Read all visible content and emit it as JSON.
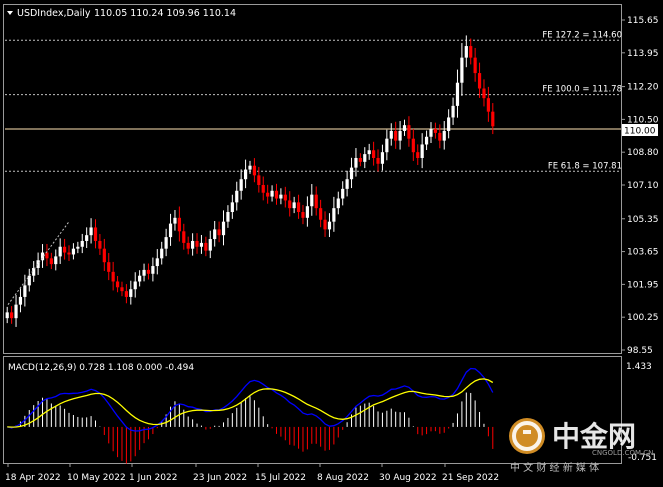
{
  "header": {
    "symbol": "USDIndex,Daily",
    "ohlc": "110.05 110.24 109.96 110.14",
    "menu_icon": "triangle-down-icon"
  },
  "price_axis": {
    "ticks": [
      "115.65",
      "113.95",
      "112.20",
      "110.50",
      "108.80",
      "107.10",
      "105.35",
      "103.65",
      "101.95",
      "100.25",
      "98.55"
    ],
    "current_price_label": "110.00"
  },
  "fib_levels": [
    {
      "label": "FE 127.2 = 114.60",
      "value": 114.6
    },
    {
      "label": "FE 100.0 = 111.78",
      "value": 111.78
    },
    {
      "label": "FE 61.8 = 107.81",
      "value": 107.81
    }
  ],
  "macd": {
    "label": "MACD(12,26,9) 0.728 1.108 0.000 -0.494",
    "axis_top": "1.433",
    "axis_bottom": "-0.751"
  },
  "time_axis": {
    "ticks": [
      "18 Apr 2022",
      "10 May 2022",
      "1 Jun 2022",
      "23 Jun 2022",
      "15 Jul 2022",
      "8 Aug 2022",
      "30 Aug 2022",
      "21 Sep 2022"
    ]
  },
  "watermark": {
    "brand": "中金网",
    "domain": "CNGOLD.COM.CN",
    "slogan": "中 文 财 经 新 媒 体",
    "logo_icon": "cngold-logo-icon"
  },
  "colors": {
    "background": "#000000",
    "bull": "#ffffff",
    "bear": "#ff0000",
    "macd_line": "#0000ff",
    "signal_line": "#ffff00",
    "fib_line": "#c0c0c0",
    "price_line": "#ffe4b5"
  },
  "chart_data": {
    "type": "candlestick",
    "title": "USDIndex,Daily",
    "price_ylim": [
      98.55,
      115.65
    ],
    "x_tick_labels": [
      "18 Apr 2022",
      "10 May 2022",
      "1 Jun 2022",
      "23 Jun 2022",
      "15 Jul 2022",
      "8 Aug 2022",
      "30 Aug 2022",
      "21 Sep 2022"
    ],
    "last_close": 110.14,
    "close": [
      100.5,
      100.2,
      100.9,
      101.3,
      101.9,
      102.4,
      102.8,
      103.2,
      103.6,
      103.3,
      103.0,
      103.4,
      103.9,
      103.6,
      103.5,
      103.8,
      103.9,
      104.2,
      104.5,
      104.9,
      104.2,
      103.8,
      103.1,
      102.6,
      102.1,
      101.8,
      101.6,
      101.3,
      101.7,
      102.1,
      102.4,
      102.7,
      102.5,
      102.9,
      103.3,
      103.8,
      104.4,
      105.1,
      105.4,
      104.7,
      104.1,
      103.8,
      104.2,
      103.9,
      104.1,
      103.7,
      104.3,
      104.8,
      104.5,
      105.2,
      105.7,
      106.2,
      106.8,
      107.4,
      107.9,
      108.1,
      107.6,
      107.1,
      106.7,
      106.5,
      106.8,
      106.4,
      106.6,
      106.3,
      105.9,
      106.2,
      105.7,
      105.4,
      106.0,
      106.6,
      105.9,
      105.3,
      104.8,
      105.2,
      105.9,
      106.4,
      106.9,
      107.4,
      108.0,
      108.5,
      108.3,
      108.7,
      108.9,
      108.5,
      108.2,
      108.8,
      109.5,
      109.9,
      109.4,
      109.9,
      110.2,
      109.5,
      108.8,
      108.5,
      109.2,
      109.6,
      110.0,
      109.8,
      109.4,
      109.9,
      110.6,
      111.2,
      112.4,
      113.7,
      114.3,
      113.7,
      112.9,
      112.1,
      111.6,
      110.9,
      110.14
    ],
    "macd": {
      "ylim": [
        -0.751,
        1.433
      ],
      "macd_value": 0.728,
      "signal_value": 1.108
    }
  }
}
